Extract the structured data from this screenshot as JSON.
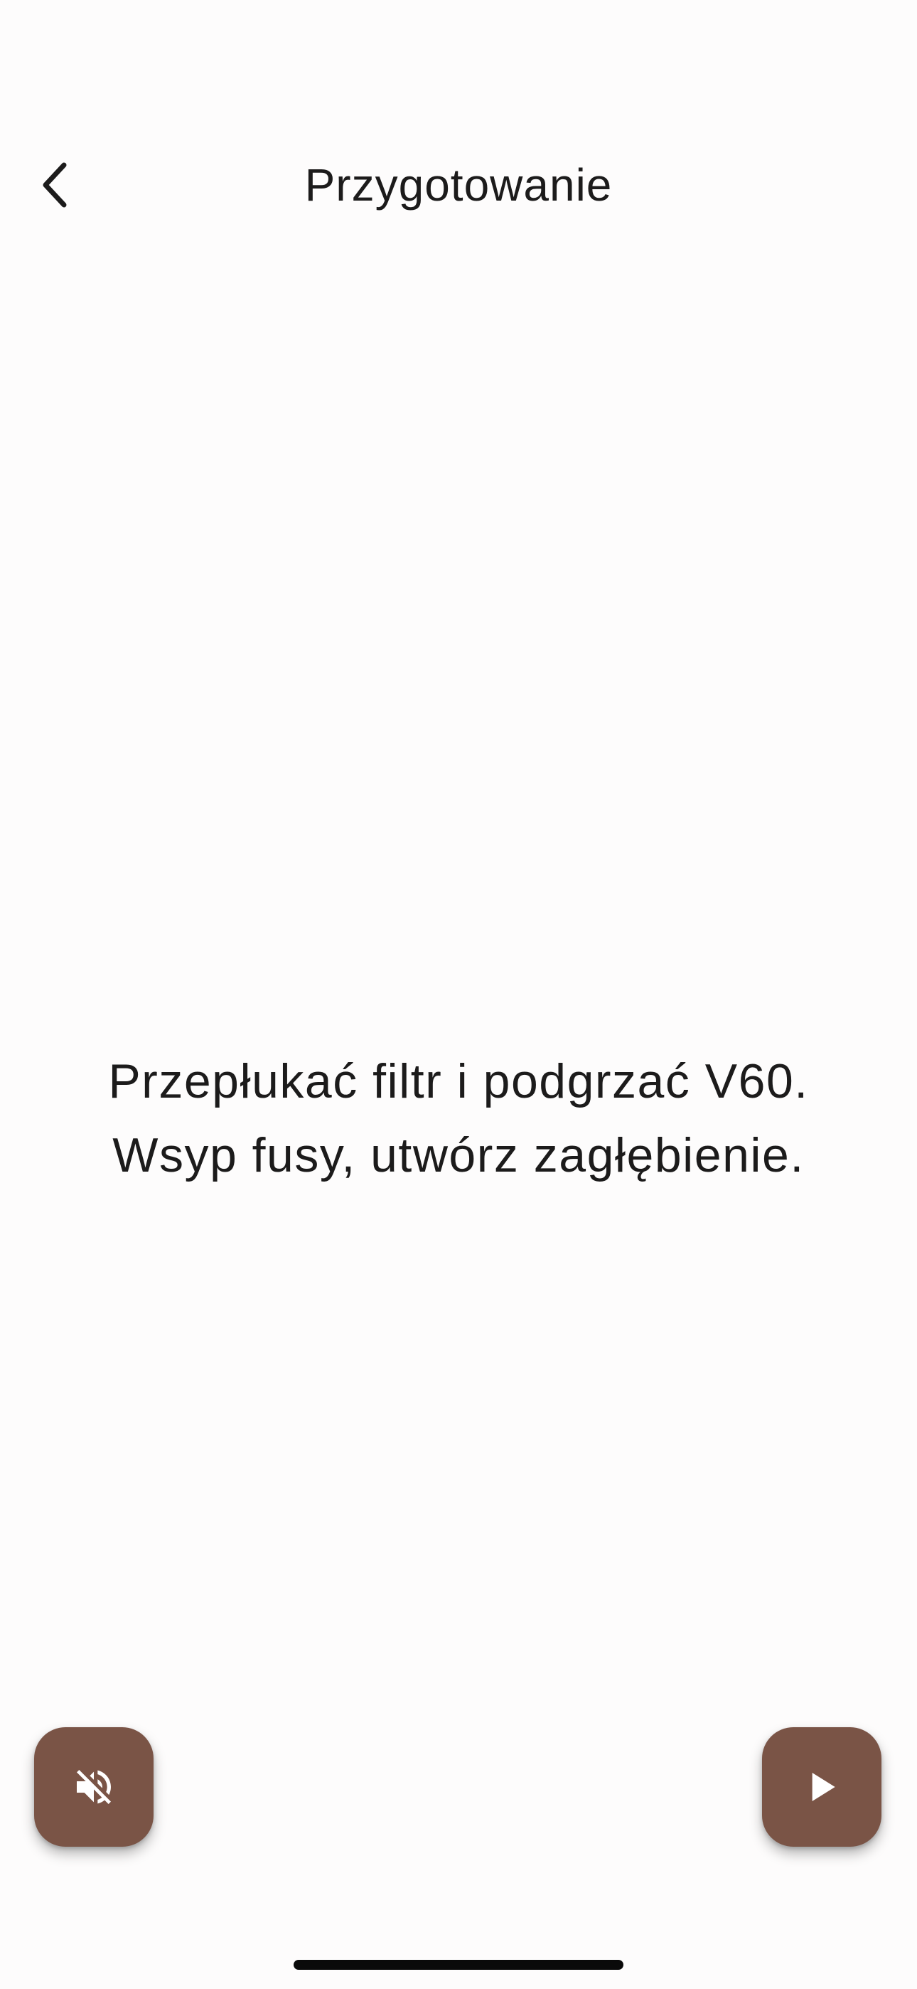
{
  "header": {
    "title": "Przygotowanie",
    "back_icon": "chevron-left-icon"
  },
  "step": {
    "instruction_lines": [
      "Przepłukać filtr i podgrzać V60.",
      "Wsyp fusy, utwórz zagłębienie."
    ]
  },
  "controls": {
    "mute_icon": "volume-off-icon",
    "play_icon": "play-icon"
  },
  "colors": {
    "background": "#fdfcfc",
    "accent": "#7a5446",
    "text": "#1c1b1b",
    "icon_on_accent": "#ffffff"
  }
}
